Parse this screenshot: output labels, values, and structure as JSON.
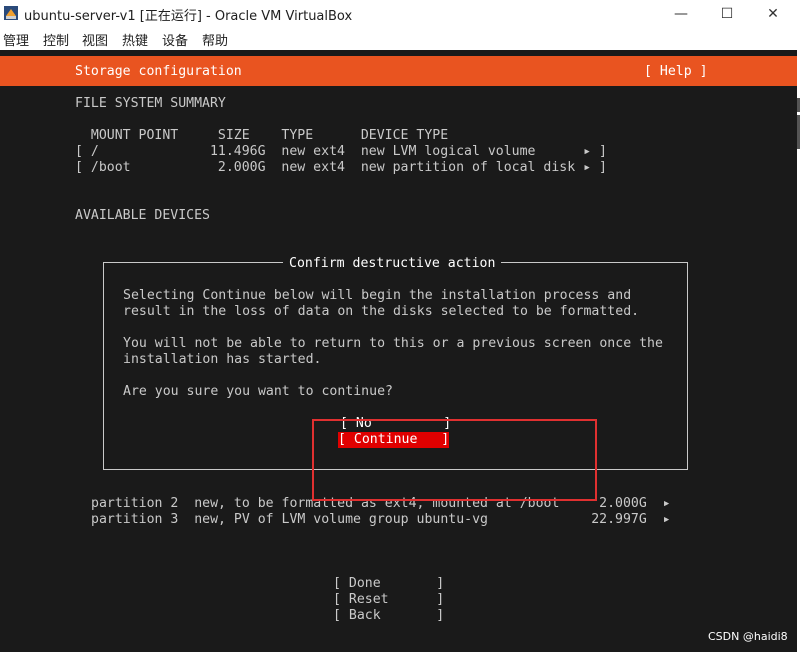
{
  "window": {
    "title": "ubuntu-server-v1 [正在运行] - Oracle VM VirtualBox",
    "minimize": "—",
    "maximize": "☐",
    "close": "✕"
  },
  "menu": [
    "管理",
    "控制",
    "视图",
    "热键",
    "设备",
    "帮助"
  ],
  "screen": {
    "header_title": "Storage configuration",
    "help": "[ Help ]",
    "fs_summary_heading": "FILE SYSTEM SUMMARY",
    "fs_columns": "  MOUNT POINT     SIZE    TYPE      DEVICE TYPE",
    "fs_rows": [
      "[ /              11.496G  new ext4  new LVM logical volume      ▸ ]",
      "[ /boot           2.000G  new ext4  new partition of local disk ▸ ]"
    ],
    "available_heading": "AVAILABLE DEVICES",
    "partitions": [
      "partition 2  new, to be formatted as ext4, mounted at /boot     2.000G  ▸",
      "partition 3  new, PV of LVM volume group ubuntu-vg             22.997G  ▸"
    ],
    "bottom_buttons": [
      "[ Done       ]",
      "[ Reset      ]",
      "[ Back       ]"
    ]
  },
  "dialog": {
    "title": "Confirm destructive action",
    "lines": [
      "Selecting Continue below will begin the installation process and",
      "result in the loss of data on the disks selected to be formatted.",
      "",
      "You will not be able to return to this or a previous screen once the",
      "installation has started.",
      "",
      "Are you sure you want to continue?"
    ],
    "no_button": "[ No         ]",
    "continue_button": "[ Continue   ]"
  },
  "watermark": "CSDN @haidi8",
  "colors": {
    "accent": "#e95420",
    "selected": "#e00000",
    "annotation": "#e03030"
  }
}
